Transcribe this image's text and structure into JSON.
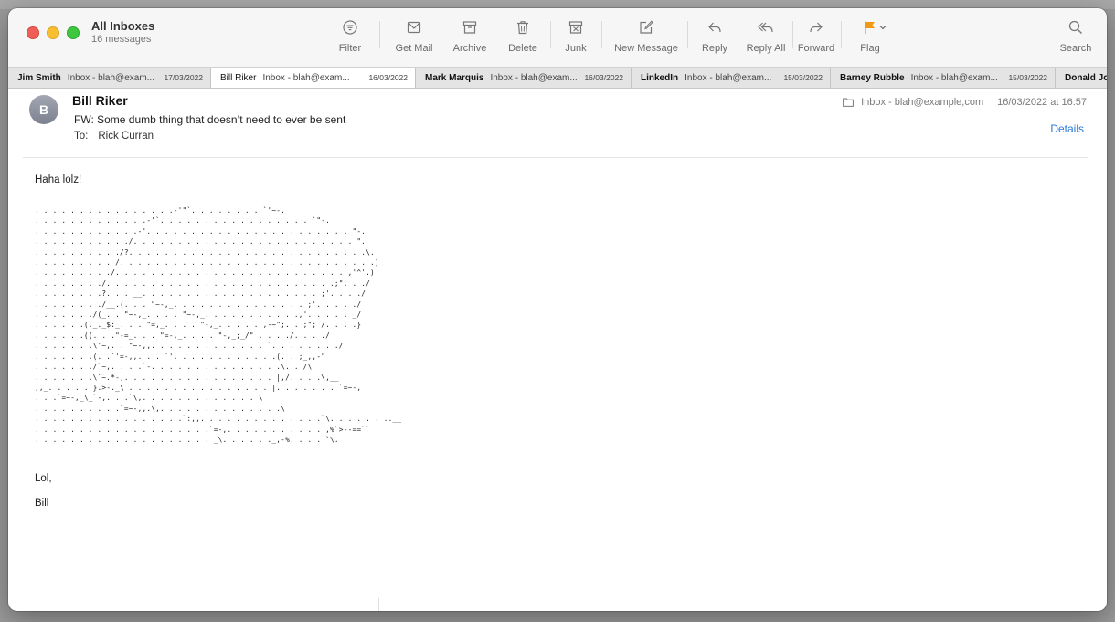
{
  "window": {
    "title": "All Inboxes",
    "subtitle": "16 messages"
  },
  "toolbar": {
    "filter": "Filter",
    "get_mail": "Get Mail",
    "archive": "Archive",
    "delete": "Delete",
    "junk": "Junk",
    "new_message": "New Message",
    "reply": "Reply",
    "reply_all": "Reply All",
    "forward": "Forward",
    "flag": "Flag",
    "search": "Search",
    "flag_color": "#f09a14"
  },
  "tabs": [
    {
      "name": "Jim Smith",
      "mailbox": "Inbox - blah@exam...",
      "date": "17/03/2022"
    },
    {
      "name": "Bill Riker",
      "mailbox": "Inbox - blah@exam...",
      "date": "16/03/2022"
    },
    {
      "name": "Mark Marquis",
      "mailbox": "Inbox - blah@exam...",
      "date": "16/03/2022"
    },
    {
      "name": "LinkedIn",
      "mailbox": "Inbox - blah@exam...",
      "date": "15/03/2022"
    },
    {
      "name": "Barney Rubble",
      "mailbox": "Inbox - blah@exam...",
      "date": "15/03/2022"
    },
    {
      "name": "Donald Jo",
      "mailbox": "",
      "date": ""
    }
  ],
  "message": {
    "avatar_initial": "B",
    "sender": "Bill Riker",
    "subject": "FW: Some dumb thing that doesn’t need to ever be sent",
    "to_label": "To:",
    "to": "Rick Curran",
    "mailbox": "Inbox - blah@example,com",
    "date": "16/03/2022 at 16:57",
    "details": "Details",
    "greeting": "Haha lolz!",
    "ascii_art": ". . . . . . . . . . . . . . . .-'\"`. . . . . . . . `'~-.\n. . . . . . . . . . . . .-'`. . . . . . . . . . . . . . . . . `\"-.\n. . . . . . . . . . . .-'. . . . . . . . . . . . . . . . . . . . . . . \"-.\n. . . . . . . . . . ./. . . . . . . . . . . . . . . . . . . . . . . . . \".\n. . . . . . . . . ./?. . . . . . . . . . . . . . . . . . . . . . . . . . .\\.\n. . . . . . . . . /. . . . . . . . . . . . . . . . . . . . . . . . . . . . .)\n. . . . . . . . ./. . . . . . . . . . . . . . . . . . . . . . . . . . ,'^'.)\n. . . . . . . ./. . . . . . . . . . . . . . . . . . . . . . . . . .;\". . ./\n. . . . . . . .?. . . __. . . . . . . . . . . . . . . . . . . . ;'. . . ./\n. . . . . . . ./__.(. . . \"~-,_. . . . . . . . . . . . . . . ;'. . . . ./\n. . . . . . ./(_. . \"~-,_. . . . \"~-,_. . . . . . . . . . .,'. . . . . _/\n. . . . . .(._._$:_. . . \"=,_. . . . \"-,_. . . . . ,-~\";. . ;\"; /. . . .}\n. . . . . .((. . .\"-=_. . . \"=-,_. . . . \"-,_;_/\" . . . ./. . . ./\n. . . . . . .\\'~,. . \"~-,,. . . . . . . . . . . . . `. . . . . . . ./\n. . . . . . .(. .`'=-,,. . . `'. . . . . . . . . . . .(. . ;_,,-\"\n. . . . . . ./`~,. . . .`-. . . . . . . . . . . . . . .\\. . /\\\n. . . . . . .\\`~.*-,. . . . . . . . . . . . . . . . . |,/. . . .\\,__\n,,_. . . . . }.>-._\\ . . . . . . . . . . . . . . . . |. . . . . . . `=~-,\n. . .`=~-,_\\_`-,. . .`\\,. . . . . . . . . . . . . \\\n. . . . . . . . . .`=~-,,.\\,. . . . . . . . . . . . . .\\\n. . . . . . . . . . . . . . . . .`:,,. . . . . . . . . . . . . .`\\. . . . . . ..__\n. . . . . . . . . . . . . . . . . . . .`=-,. . . . . . . . . . . ,%`>--==``\n. . . . . . . . . . . . . . . . . . . . _\\. . . . . ._,-%. . . . `\\.",
    "closing": "Lol,",
    "signoff": "Bill"
  }
}
